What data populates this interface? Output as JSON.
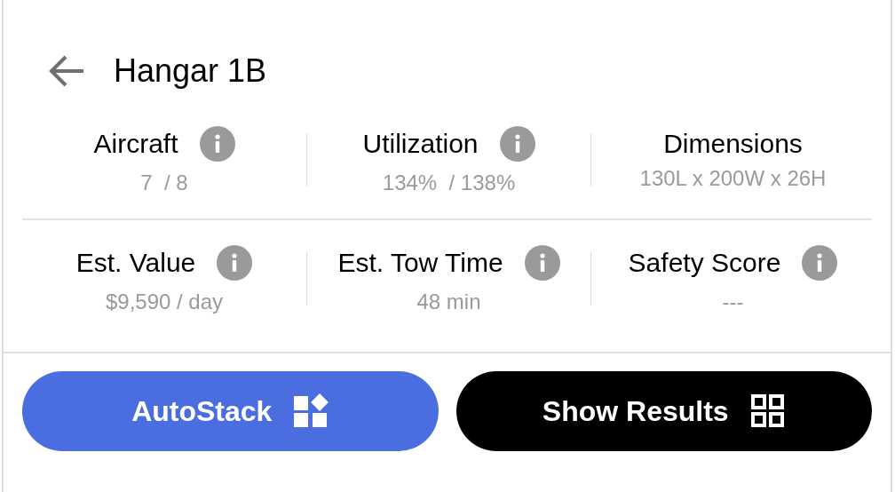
{
  "header": {
    "title": "Hangar 1B"
  },
  "stats": [
    {
      "label": "Aircraft",
      "value": "7  / 8",
      "info": true
    },
    {
      "label": "Utilization",
      "value": "134%  / 138%",
      "info": true
    },
    {
      "label": "Dimensions",
      "value": "130L x 200W x 26H",
      "info": false
    },
    {
      "label": "Est. Value",
      "value": "$9,590 / day",
      "info": true
    },
    {
      "label": "Est. Tow Time",
      "value": "48 min",
      "info": true
    },
    {
      "label": "Safety Score",
      "value": "---",
      "info": true
    }
  ],
  "buttons": [
    {
      "label": "AutoStack",
      "kind": "autostack"
    },
    {
      "label": "Show Results",
      "kind": "results"
    }
  ]
}
